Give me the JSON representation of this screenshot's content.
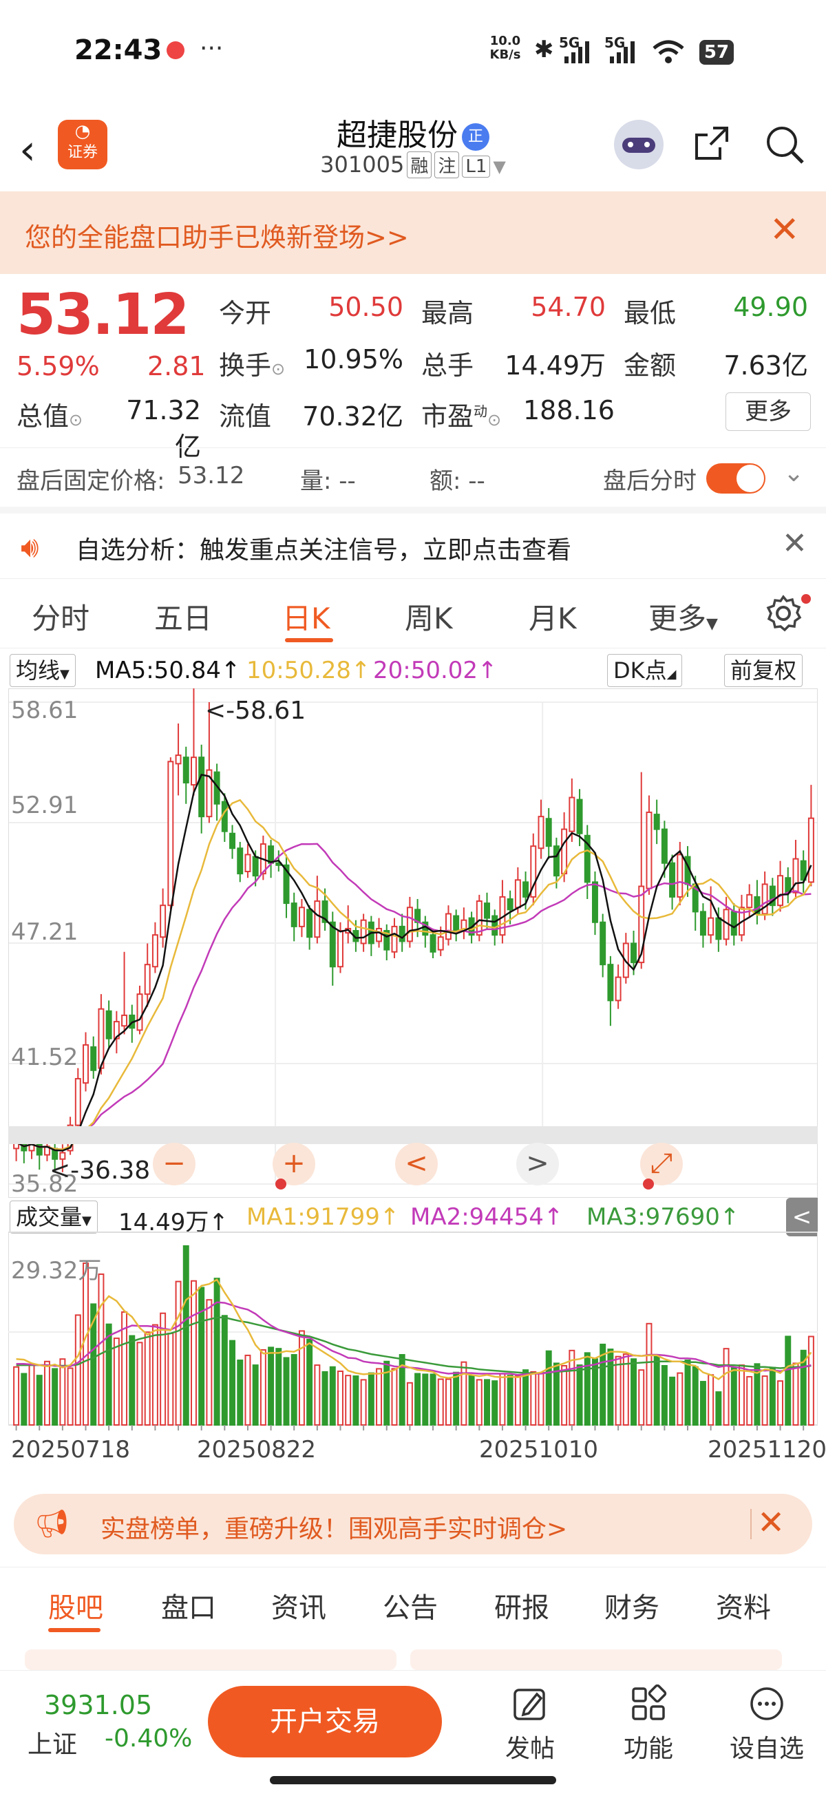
{
  "status_bar": {
    "time": "22:43",
    "dots": "···",
    "net_speed": "10.0 KB/s",
    "signal_1": "5G",
    "signal_2": "5G",
    "battery": "57"
  },
  "header": {
    "logo_text": "证券",
    "stock_name": "超捷股份",
    "badge": "正",
    "stock_code": "301005",
    "tags": [
      "融",
      "注",
      "L1"
    ]
  },
  "promo": {
    "text": "您的全能盘口助手已焕新登场>>"
  },
  "quote": {
    "price": "53.12",
    "change_pct": "5.59%",
    "change": "2.81",
    "open_label": "今开",
    "open": "50.50",
    "high_label": "最高",
    "high": "54.70",
    "low_label": "最低",
    "low": "49.90",
    "turnover_label": "换手",
    "turnover": "10.95%",
    "volume_label": "总手",
    "volume": "14.49万",
    "amount_label": "金额",
    "amount": "7.63亿",
    "mktcap_label": "总值",
    "mktcap": "71.32亿",
    "float_label": "流值",
    "float": "70.32亿",
    "pe_label": "市盈",
    "pe_sup": "动",
    "pe": "188.16",
    "more": "更多"
  },
  "after_hours": {
    "fixed_price_label": "盘后固定价格:",
    "fixed_price": "53.12",
    "qty_label": "量: --",
    "amt_label": "额: --",
    "timeshare_label": "盘后分时"
  },
  "notice": {
    "text": "自选分析：触发重点关注信号，立即点击查看"
  },
  "chart_tabs": [
    "分时",
    "五日",
    "日K",
    "周K",
    "月K",
    "更多"
  ],
  "ma_row": {
    "selector": "均线",
    "ma5": "MA5:50.84↑",
    "ma10": "10:50.28↑",
    "ma20": "20:50.02↑",
    "dk": "DK点",
    "adjust": "前复权"
  },
  "controls": [
    "−",
    "+",
    "<",
    ">",
    "⤢"
  ],
  "volume_row": {
    "selector": "成交量",
    "vol": "14.49万↑",
    "ma1": "MA1:91799↑",
    "ma2": "MA2:94454↑",
    "ma3": "MA3:97690↑",
    "collapse": "<"
  },
  "x_labels": [
    "20250718",
    "20250822",
    "20251010",
    "20251120"
  ],
  "chart_data": [
    {
      "type": "candlestick",
      "y_ticks": [
        "58.61",
        "52.91",
        "47.21",
        "41.52",
        "35.82"
      ],
      "ylim": [
        35.82,
        58.61
      ],
      "high_marker": "<-58.61",
      "low_marker": "<-36.38",
      "colors": {
        "up": "#e03a3a",
        "down": "#2e9a2e",
        "ma5": "#111111",
        "ma10": "#e8b93a",
        "ma20": "#c23ab8"
      },
      "candles": [
        [
          37.5,
          37.8,
          36.9,
          38.2
        ],
        [
          37.7,
          37.4,
          36.8,
          38.0
        ],
        [
          37.4,
          37.9,
          37.0,
          38.3
        ],
        [
          37.8,
          37.2,
          36.5,
          38.1
        ],
        [
          37.2,
          37.6,
          36.9,
          38.0
        ],
        [
          37.5,
          37.0,
          36.4,
          37.9
        ],
        [
          37.0,
          37.3,
          36.38,
          37.7
        ],
        [
          37.4,
          38.6,
          37.2,
          39.0
        ],
        [
          38.6,
          40.8,
          38.4,
          41.3
        ],
        [
          40.6,
          42.4,
          40.2,
          43.0
        ],
        [
          42.3,
          41.2,
          40.8,
          42.8
        ],
        [
          41.3,
          44.1,
          41.0,
          44.8
        ],
        [
          44.0,
          42.7,
          42.2,
          44.5
        ],
        [
          42.7,
          43.5,
          42.0,
          44.0
        ],
        [
          43.3,
          43.8,
          42.9,
          46.8
        ],
        [
          43.8,
          43.2,
          42.5,
          44.3
        ],
        [
          43.1,
          44.8,
          42.9,
          45.2
        ],
        [
          44.8,
          46.2,
          44.2,
          47.2
        ],
        [
          46.1,
          47.6,
          45.8,
          48.2
        ],
        [
          47.5,
          49.0,
          47.0,
          49.8
        ],
        [
          49.0,
          55.8,
          48.8,
          56.0
        ],
        [
          55.7,
          56.1,
          54.2,
          57.6
        ],
        [
          56.0,
          54.8,
          53.8,
          56.5
        ],
        [
          54.7,
          56.0,
          54.2,
          59.9
        ],
        [
          56.0,
          53.2,
          52.4,
          56.6
        ],
        [
          53.2,
          55.4,
          52.9,
          58.61
        ],
        [
          55.3,
          53.8,
          53.0,
          55.7
        ],
        [
          53.9,
          52.5,
          52.0,
          54.3
        ],
        [
          52.4,
          51.7,
          51.2,
          52.8
        ],
        [
          51.7,
          50.5,
          50.1,
          52.0
        ],
        [
          50.6,
          51.4,
          50.3,
          51.9
        ],
        [
          51.3,
          50.4,
          49.9,
          51.6
        ],
        [
          50.5,
          51.9,
          50.2,
          52.3
        ],
        [
          51.8,
          51.0,
          50.3,
          52.1
        ],
        [
          51.0,
          50.9,
          50.6,
          51.6
        ],
        [
          50.9,
          49.1,
          48.4,
          51.4
        ],
        [
          49.1,
          48.0,
          47.3,
          49.6
        ],
        [
          48.0,
          48.9,
          47.5,
          49.3
        ],
        [
          48.8,
          47.5,
          46.9,
          49.0
        ],
        [
          47.5,
          49.2,
          47.2,
          50.4
        ],
        [
          49.2,
          48.2,
          47.8,
          49.8
        ],
        [
          48.2,
          46.1,
          45.2,
          48.7
        ],
        [
          46.1,
          47.8,
          45.8,
          48.2
        ],
        [
          47.7,
          47.9,
          47.2,
          49.0
        ],
        [
          47.8,
          47.3,
          46.8,
          48.3
        ],
        [
          47.2,
          48.3,
          46.8,
          48.6
        ],
        [
          48.2,
          47.2,
          46.6,
          48.5
        ],
        [
          47.3,
          47.9,
          47.0,
          48.4
        ],
        [
          47.8,
          46.9,
          46.4,
          48.1
        ],
        [
          46.8,
          48.0,
          46.5,
          48.4
        ],
        [
          48.0,
          47.3,
          46.8,
          48.6
        ],
        [
          47.3,
          48.9,
          47.0,
          49.4
        ],
        [
          48.8,
          48.2,
          47.5,
          49.3
        ],
        [
          48.2,
          47.6,
          47.0,
          48.5
        ],
        [
          47.6,
          46.8,
          46.5,
          47.9
        ],
        [
          46.9,
          47.5,
          46.6,
          48.0
        ],
        [
          47.4,
          48.6,
          47.1,
          49.0
        ],
        [
          48.5,
          47.8,
          47.3,
          48.8
        ],
        [
          47.8,
          48.3,
          47.4,
          48.9
        ],
        [
          48.4,
          47.6,
          47.2,
          48.7
        ],
        [
          47.6,
          49.2,
          47.3,
          49.5
        ],
        [
          49.1,
          48.4,
          47.9,
          49.6
        ],
        [
          48.5,
          47.6,
          47.1,
          48.8
        ],
        [
          47.6,
          49.4,
          47.2,
          50.2
        ],
        [
          49.3,
          48.8,
          48.1,
          49.7
        ],
        [
          48.9,
          50.2,
          48.6,
          50.8
        ],
        [
          50.1,
          49.4,
          48.8,
          50.6
        ],
        [
          49.4,
          51.8,
          49.0,
          52.4
        ],
        [
          51.7,
          53.2,
          51.2,
          54.0
        ],
        [
          53.1,
          51.8,
          51.2,
          53.6
        ],
        [
          51.8,
          50.4,
          49.8,
          52.2
        ],
        [
          50.5,
          52.6,
          50.1,
          53.4
        ],
        [
          52.5,
          54.1,
          52.0,
          55.0
        ],
        [
          54.0,
          52.4,
          51.8,
          54.5
        ],
        [
          52.3,
          50.1,
          49.3,
          52.8
        ],
        [
          50.1,
          48.2,
          47.6,
          50.6
        ],
        [
          48.2,
          46.2,
          45.6,
          48.6
        ],
        [
          46.2,
          44.5,
          43.3,
          46.6
        ],
        [
          44.5,
          45.6,
          44.1,
          46.2
        ],
        [
          45.6,
          47.2,
          45.3,
          47.7
        ],
        [
          47.2,
          46.3,
          45.7,
          47.8
        ],
        [
          46.3,
          49.9,
          46.0,
          55.3
        ],
        [
          49.8,
          53.4,
          49.5,
          54.2
        ],
        [
          53.3,
          52.6,
          51.9,
          54.0
        ],
        [
          52.6,
          51.0,
          50.3,
          53.0
        ],
        [
          51.0,
          49.4,
          48.8,
          51.4
        ],
        [
          49.4,
          51.4,
          49.0,
          52.0
        ],
        [
          51.3,
          50.0,
          49.4,
          51.8
        ],
        [
          50.0,
          48.7,
          47.8,
          50.4
        ],
        [
          48.7,
          47.6,
          47.0,
          49.1
        ],
        [
          47.6,
          48.4,
          47.2,
          49.9
        ],
        [
          48.4,
          47.4,
          46.8,
          48.9
        ],
        [
          47.4,
          48.8,
          47.1,
          49.4
        ],
        [
          48.7,
          47.6,
          47.1,
          49.1
        ],
        [
          47.6,
          48.9,
          47.3,
          49.5
        ],
        [
          48.9,
          49.5,
          48.4,
          50.0
        ],
        [
          49.4,
          48.6,
          48.1,
          50.2
        ],
        [
          48.6,
          50.0,
          48.3,
          50.6
        ],
        [
          49.9,
          49.0,
          48.5,
          50.3
        ],
        [
          49.0,
          50.4,
          48.7,
          51.1
        ],
        [
          50.3,
          49.6,
          49.1,
          50.8
        ],
        [
          49.6,
          51.2,
          49.3,
          52.1
        ],
        [
          51.1,
          50.2,
          49.6,
          51.6
        ],
        [
          50.1,
          53.12,
          49.9,
          54.7
        ]
      ]
    },
    {
      "type": "volume_bars",
      "y_tick": "29.32万",
      "ymax": 29.32,
      "unit": "万",
      "values": [
        9.5,
        8.4,
        9.9,
        8.1,
        10.4,
        9.2,
        10.8,
        9.3,
        18.0,
        26.5,
        19.8,
        24.7,
        16.5,
        14.2,
        18.5,
        14.6,
        13.5,
        15.2,
        16.4,
        18.3,
        15.0,
        23.5,
        29.32,
        23.6,
        22.5,
        20.5,
        24.0,
        17.9,
        13.8,
        10.6,
        11.4,
        9.8,
        12.3,
        12.7,
        12.5,
        11.0,
        11.5,
        15.4,
        14.0,
        9.8,
        8.7,
        9.5,
        8.8,
        8.1,
        8.0,
        7.4,
        8.5,
        9.2,
        10.4,
        9.2,
        11.5,
        6.9,
        8.4,
        8.3,
        8.3,
        7.5,
        7.5,
        8.6,
        10.3,
        8.1,
        7.4,
        7.4,
        7.2,
        8.4,
        8.1,
        8.0,
        9.0,
        8.7,
        8.5,
        12.1,
        10.1,
        9.7,
        12.2,
        9.8,
        11.8,
        10.8,
        13.2,
        12.4,
        11.2,
        11.6,
        10.8,
        9.0,
        16.6,
        11.4,
        9.7,
        7.8,
        8.5,
        10.6,
        9.5,
        7.1,
        8.2,
        5.4,
        12.5,
        9.4,
        9.8,
        7.9,
        10.0,
        8.0,
        9.4,
        7.2,
        14.5,
        10.1,
        12.2,
        14.49
      ],
      "ma1": [
        10.8,
        10.7,
        10.1,
        9.8,
        9.6,
        9.9,
        9.4,
        9.8,
        11.3,
        14.4,
        17.0,
        19.6,
        21.1,
        20.3,
        18.7,
        17.7,
        15.9,
        14.8,
        15.5,
        15.6,
        15.5,
        17.7,
        20.5,
        21.4,
        22.8,
        23.1,
        23.8,
        21.7,
        19.8,
        17.5,
        15.6,
        13.1,
        11.7,
        11.8,
        11.8,
        12.1,
        12.0,
        12.6,
        13.4,
        12.6,
        11.8,
        11.0,
        10.1,
        8.9,
        8.5,
        8.3,
        8.4,
        8.4,
        8.6,
        9.0,
        9.8,
        9.4,
        9.0,
        8.9,
        8.7,
        7.9,
        7.7,
        7.9,
        8.4,
        8.2,
        8.0,
        8.2,
        7.9,
        7.8,
        7.9,
        7.8,
        8.1,
        8.4,
        8.6,
        9.3,
        9.7,
        10.1,
        10.6,
        10.8,
        11.2,
        10.9,
        11.5,
        12.0,
        12.0,
        11.9,
        11.4,
        11.3,
        11.4,
        11.4,
        10.8,
        10.4,
        10.4,
        9.9,
        9.7,
        8.6,
        8.2,
        7.5,
        8.5,
        9.0,
        8.9,
        8.8,
        8.5,
        9.1,
        9.0,
        8.5,
        9.6,
        10.0,
        10.3,
        11.9
      ],
      "ma2": [
        10.0,
        10.0,
        9.9,
        9.8,
        9.8,
        9.7,
        9.6,
        9.6,
        10.2,
        11.3,
        12.4,
        13.5,
        14.6,
        15.2,
        15.8,
        16.3,
        16.2,
        16.2,
        16.1,
        15.8,
        15.6,
        16.2,
        17.3,
        18.0,
        18.6,
        19.2,
        20.1,
        20.0,
        19.6,
        19.2,
        18.9,
        18.2,
        17.2,
        16.3,
        15.6,
        15.2,
        14.8,
        14.4,
        14.3,
        13.5,
        12.8,
        12.1,
        11.6,
        11.0,
        10.9,
        10.4,
        10.2,
        10.1,
        9.9,
        9.6,
        9.5,
        9.4,
        9.3,
        9.1,
        8.9,
        8.6,
        8.4,
        8.5,
        8.5,
        8.5,
        8.4,
        8.4,
        8.4,
        8.4,
        8.4,
        8.2,
        8.3,
        8.4,
        8.4,
        8.6,
        8.8,
        9.0,
        9.2,
        9.5,
        9.7,
        9.9,
        10.3,
        10.5,
        10.8,
        11.2,
        11.4,
        11.3,
        11.5,
        11.5,
        11.4,
        11.2,
        10.9,
        10.9,
        10.8,
        10.4,
        9.9,
        9.5,
        9.7,
        9.5,
        9.3,
        9.0,
        9.0,
        8.9,
        9.0,
        8.8,
        9.1,
        9.3,
        9.5,
        9.8
      ],
      "ma3": [
        9.8,
        9.8,
        9.8,
        9.8,
        9.8,
        9.7,
        9.7,
        9.7,
        9.9,
        10.5,
        11.0,
        11.7,
        12.3,
        12.8,
        13.3,
        13.7,
        14.1,
        14.4,
        14.7,
        14.8,
        15.0,
        15.4,
        16.1,
        16.6,
        17.0,
        17.3,
        17.6,
        17.6,
        17.3,
        17.0,
        16.8,
        16.5,
        16.2,
        15.9,
        15.6,
        15.3,
        15.0,
        14.7,
        14.5,
        14.1,
        13.7,
        13.2,
        12.8,
        12.4,
        12.2,
        11.9,
        11.6,
        11.4,
        11.2,
        11.0,
        10.8,
        10.6,
        10.4,
        10.2,
        10.0,
        9.8,
        9.6,
        9.5,
        9.4,
        9.3,
        9.1,
        9.0,
        8.9,
        8.8,
        8.7,
        8.6,
        8.5,
        8.5,
        8.5,
        8.6,
        8.7,
        8.8,
        8.9,
        9.0,
        9.2,
        9.3,
        9.5,
        9.7,
        9.9,
        10.0,
        10.1,
        10.2,
        10.3,
        10.4,
        10.4,
        10.4,
        10.4,
        10.3,
        10.3,
        10.1,
        10.0,
        9.8,
        9.8,
        9.8,
        9.7,
        9.6,
        9.5,
        9.5,
        9.4,
        9.3,
        9.4,
        9.5,
        9.5,
        9.7
      ],
      "colors": {
        "ma1": "#e8b93a",
        "ma2": "#c23ab8",
        "ma3": "#3a9a3a"
      }
    }
  ],
  "ad": {
    "text": "实盘榜单，重磅升级！围观高手实时调仓>"
  },
  "bottom_tabs": [
    "股吧",
    "盘口",
    "资讯",
    "公告",
    "研报",
    "财务",
    "资料"
  ],
  "footer": {
    "index_value": "3931.05",
    "index_name": "上证",
    "index_pct": "-0.40%",
    "trade": "开户交易",
    "post": "发帖",
    "functions": "功能",
    "watchlist": "设自选"
  }
}
